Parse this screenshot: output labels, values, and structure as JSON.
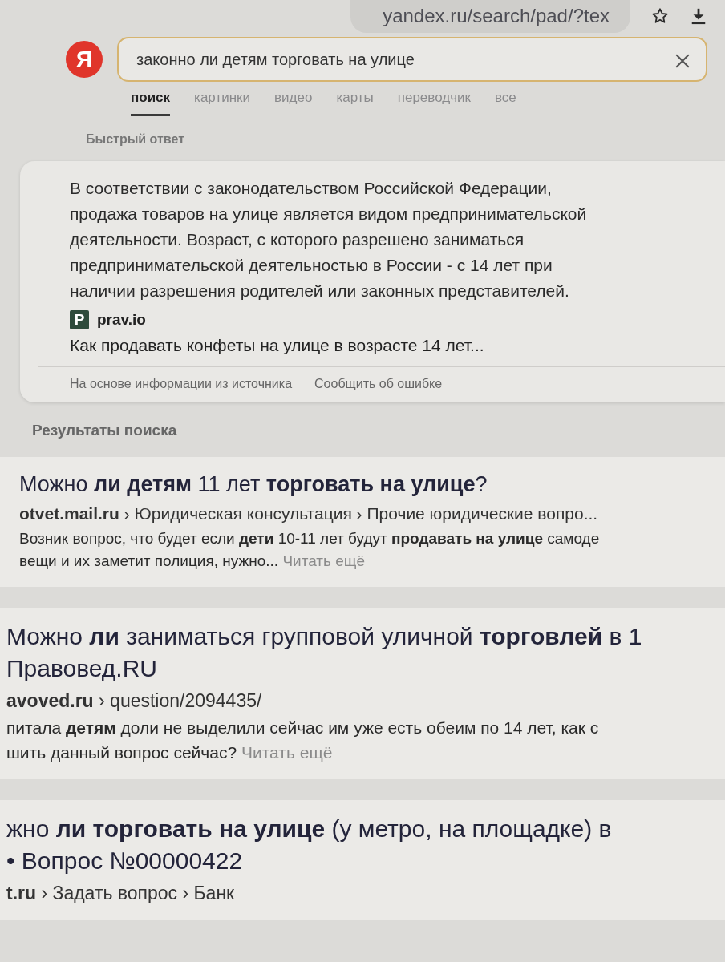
{
  "browser_bar": {
    "url": "yandex.ru/search/pad/?tex"
  },
  "search": {
    "logo": "Я",
    "value": "законно ли детям торговать на улице"
  },
  "tabs": [
    {
      "label": "поиск",
      "selected": true
    },
    {
      "label": "картинки",
      "selected": false
    },
    {
      "label": "видео",
      "selected": false
    },
    {
      "label": "карты",
      "selected": false
    },
    {
      "label": "переводчик",
      "selected": false
    },
    {
      "label": "все",
      "selected": false
    }
  ],
  "quick_answer": {
    "heading": "Быстрый ответ",
    "text": "В соответствии с законодательством Российской Федерации, продажа товаров на улице является видом предпринимательской деятельности. Возраст, с которого разрешено заниматься предпринимательской деятельностью в России - с 14 лет при наличии разрешения родителей или законных представителей.",
    "source_icon": "P",
    "source": "prav.io",
    "link": "Как продавать конфеты на улице в возрасте 14 лет...",
    "note": "На основе информации из источника",
    "report": "Сообщить об ошибке"
  },
  "results_heading": "Результаты поиска",
  "results": [
    {
      "title_lines": [
        "Можно **ли детям** 11 лет **торговать на улице**?"
      ],
      "breadcrumb": "**otvet.mail.ru** › Юридическая консультация › Прочие юридические вопро...",
      "snippet_lines": [
        "Возник вопрос, что будет если **дети** 10-11 лет будут **продавать на улице** самоде",
        "вещи и их заметит полиция, нужно..."
      ],
      "more": "Читать ещё"
    },
    {
      "title_lines": [
        "Можно **ли** заниматься групповой уличной **торговлей** в 1",
        "Правовед.RU"
      ],
      "breadcrumb": "**avoved.ru** › question/2094435/",
      "snippet_lines": [
        "питала **детям** доли не выделили сейчас им уже есть обеим по 14 лет, как с",
        "шить данный вопрос сейчас?"
      ],
      "more": "Читать ещё"
    },
    {
      "title_lines": [
        "жно **ли торговать на улице** (у метро, на площадке) в",
        "• Вопрос №00000422"
      ],
      "breadcrumb": "**t.ru** › Задать вопрос › Банк"
    }
  ]
}
